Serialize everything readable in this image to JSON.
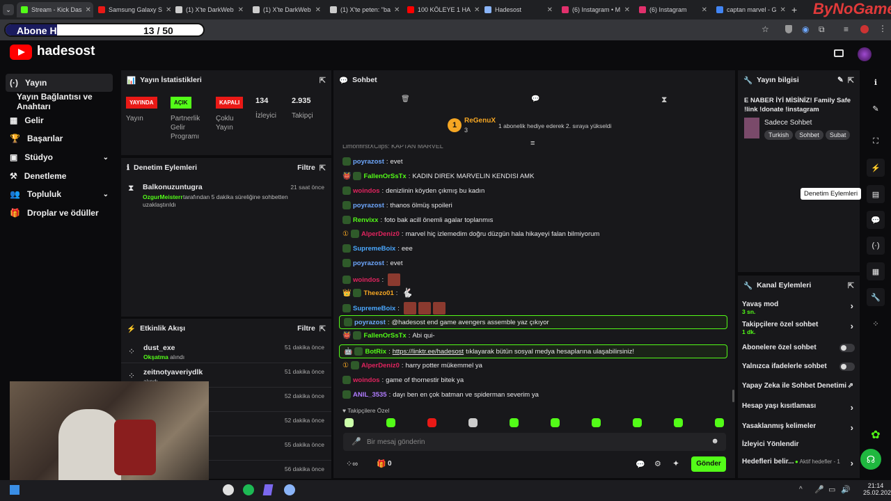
{
  "browser": {
    "tabs": [
      "Stream - Kick Das",
      "Samsung Galaxy S",
      "(1) X'te DarkWeb",
      "(1) X'te DarkWeb",
      "(1) X'te peten: \"ba",
      "100 KÖLEYE 1 HA",
      "Hadesost",
      "(6) Instagram • M",
      "(6) Instagram",
      "captan marvel - G"
    ],
    "new_tab": "+",
    "overlay_brand": "ByNoGame"
  },
  "goal": {
    "label": "Abone Hedefi:",
    "current": 13,
    "target": 50,
    "count_text": "13 / 50"
  },
  "channel": {
    "name": "hadesost"
  },
  "sidebar": {
    "items": [
      {
        "label": "Yayın",
        "icon": "broadcast-icon"
      },
      {
        "label": "Yayın Bağlantısı ve Anahtarı"
      },
      {
        "label": "Gelir",
        "icon": "revenue-icon"
      },
      {
        "label": "Başarılar",
        "icon": "trophy-icon"
      },
      {
        "label": "Stüdyo",
        "icon": "studio-icon"
      },
      {
        "label": "Denetleme",
        "icon": "hammer-icon"
      },
      {
        "label": "Topluluk",
        "icon": "community-icon"
      },
      {
        "label": "Droplar ve ödüller",
        "icon": "drops-icon"
      }
    ]
  },
  "stats": {
    "title": "Yayın İstatistikleri",
    "live_badge": "YAYINDA",
    "live_label": "Yayın",
    "partner_badge": "AÇIK",
    "partner_label": "Partnerlik Gelir Programı",
    "multi_badge": "KAPALI",
    "multi_label": "Çoklu Yayın",
    "viewers": "134",
    "viewers_label": "İzleyici",
    "followers": "2.935",
    "followers_label": "Takipçi"
  },
  "mod_actions": {
    "title": "Denetim Eylemleri",
    "filter": "Filtre",
    "entry": {
      "user": "Balkonuzuntugra",
      "time": "21 saat önce",
      "actor": "OzgurMeisterr",
      "text": "tarafından 5 dakika süreliğine sohbetten uzaklaştırıldı"
    }
  },
  "activity": {
    "title": "Etkinlik Akışı",
    "filter": "Filtre",
    "rows": [
      {
        "name": "dust_exe",
        "sub_hl": "Okşatma",
        "sub": "alındı",
        "time": "51 dakika önce"
      },
      {
        "name": "zeitnotyaveriydlk",
        "sub_hl": "",
        "sub": "alındı",
        "time": "51 dakika önce"
      },
      {
        "name": "",
        "sub_hl": "",
        "sub": "",
        "time": "52 dakika önce"
      },
      {
        "name": "",
        "sub_hl": "",
        "sub": "alındı",
        "time": "52 dakika önce"
      },
      {
        "name": "",
        "sub_hl": "",
        "sub": "alındı",
        "time": "55 dakika önce"
      },
      {
        "name": "",
        "sub_hl": "",
        "sub": "",
        "time": "56 dakika önce"
      }
    ]
  },
  "chat": {
    "title": "Sohbet",
    "pinned": {
      "user": "ReGenuX",
      "count": "3",
      "text": "1 abonelik hediye ederek 2. sıraya yükseldi"
    },
    "cut_line": "LimonfirstXClips: KAPTAN MARVEL",
    "messages": [
      {
        "user": "poyrazost",
        "color": "#6ea8ff",
        "text": "evet"
      },
      {
        "user": "FallenOrSsTx",
        "color": "#53fc18",
        "text": "KADIN DIREK MARVELIN KENDISI AMK"
      },
      {
        "user": "woindos",
        "color": "#e0245e",
        "text": "denizlinin köyden çıkmış bu kadın"
      },
      {
        "user": "poyrazost",
        "color": "#6ea8ff",
        "text": "thanos ölmüş spoileri"
      },
      {
        "user": "Renvixx",
        "color": "#53fc18",
        "text": "foto bak acill önemli agalar toplanmıs"
      },
      {
        "user": "AlperDeniz0",
        "color": "#e0245e",
        "text": "marvel hiç izlemedim doğru düzgün hala hikayeyi falan bilmiyorum"
      },
      {
        "user": "SupremeBoix",
        "color": "#4aa8ff",
        "text": "eee"
      },
      {
        "user": "poyrazost",
        "color": "#6ea8ff",
        "text": "evet"
      },
      {
        "user": "woindos",
        "color": "#e0245e",
        "text": ""
      },
      {
        "user": "Theezo01",
        "color": "#f5a623",
        "text": ""
      },
      {
        "user": "SupremeBoix",
        "color": "#4aa8ff",
        "text": ""
      },
      {
        "user": "poyrazost",
        "color": "#6ea8ff",
        "text": "@hadesost end game avengers assemble yaz çıkıyor"
      },
      {
        "user": "FallenOrSsTx",
        "color": "#53fc18",
        "text": "Abi qui-"
      },
      {
        "user": "BotRix",
        "color": "#53fc18",
        "text_link": "https://linktr.ee/hadesost",
        "text": "tıklayarak bütün sosyal medya hesaplarına ulaşabilirsiniz!"
      },
      {
        "user": "AlperDeniz0",
        "color": "#e0245e",
        "text": "harry potter mükemmel ya"
      },
      {
        "user": "woindos",
        "color": "#e0245e",
        "text": "game of thornestir bitek ya"
      },
      {
        "user": "ANIL_3535",
        "color": "#b07cff",
        "text": "dayı ben en çok batman ve spiderman severim ya"
      }
    ],
    "followers_only": "Takipçilere Özel",
    "placeholder": "Bir mesaj gönderin",
    "send": "Gönder",
    "points": "0"
  },
  "stream_info": {
    "title": "Yayın bilgisi",
    "stream_title": "E NABER İYİ MİSİNİZ! Family Safe !link !donate !instagram",
    "category": "Sadece Sohbet",
    "tags": [
      "Turkish",
      "Sohbet",
      "Subat"
    ]
  },
  "channel_actions": {
    "title": "Kanal Eylemleri",
    "rows": [
      {
        "label": "Yavaş mod",
        "sub": "3 sn.",
        "kind": "arrow"
      },
      {
        "label": "Takipçilere özel sohbet",
        "sub": "1 dk.",
        "kind": "arrow"
      },
      {
        "label": "Abonelere özel sohbet",
        "sub": "",
        "kind": "toggle"
      },
      {
        "label": "Yalnızca ifadelerle sohbet",
        "sub": "",
        "kind": "toggle"
      },
      {
        "label": "Yapay Zeka ile Sohbet Denetimi",
        "sub": "",
        "kind": "ext"
      },
      {
        "label": "Hesap yaşı kısıtlaması",
        "sub": "",
        "kind": "arrow"
      },
      {
        "label": "Yasaklanmış kelimeler",
        "sub": "",
        "kind": "arrow"
      },
      {
        "label": "İzleyici Yönlendir",
        "sub": "",
        "kind": "none"
      },
      {
        "label": "Hedefleri belir...",
        "sub": "",
        "kind": "goal",
        "extra": "Aktif hedefler - 1"
      }
    ]
  },
  "tooltip": "Denetim Eylemleri",
  "clock": {
    "time": "21:14",
    "date": "25.02.2026"
  },
  "colors": {
    "accent": "#53fc18",
    "panel": "#18181b",
    "bg": "#0b0b0d",
    "live": "#e91916"
  }
}
